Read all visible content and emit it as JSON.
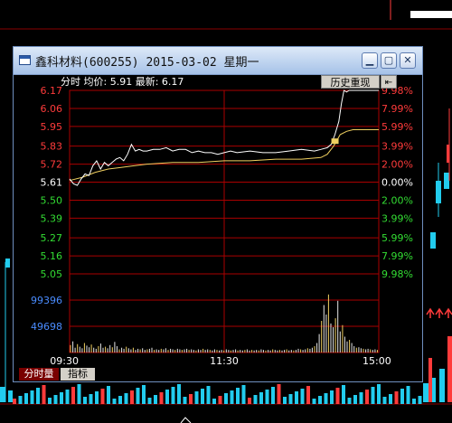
{
  "window": {
    "title": "鑫科材料(600255) 2015-03-02 星期一",
    "min_glyph": "▁",
    "max_glyph": "▢",
    "close_glyph": "✕"
  },
  "header": {
    "line": "分时 均价: 5.91 最新: 6.17",
    "history_button": "历史重现",
    "jump_glyph": "⇤"
  },
  "tabs": [
    "分时量",
    "指标"
  ],
  "colors": {
    "up": "#ff3b3b",
    "down": "#33dd33",
    "neutral": "#ffffff",
    "grid": "#aa0000",
    "price_line": "#ffffff",
    "avg_line": "#f0d060",
    "volume": "#e8e8e8"
  },
  "chart_data": {
    "type": "line",
    "price_axis": {
      "ticks": [
        "6.17",
        "6.06",
        "5.95",
        "5.83",
        "5.72",
        "5.61",
        "5.50",
        "5.39",
        "5.27",
        "5.16",
        "5.05"
      ],
      "tick_values": [
        6.17,
        6.06,
        5.95,
        5.83,
        5.72,
        5.61,
        5.5,
        5.39,
        5.27,
        5.16,
        5.05
      ],
      "ylim": [
        5.05,
        6.17
      ],
      "prev_close": 5.61
    },
    "pct_axis": [
      "9.98%",
      "7.99%",
      "5.99%",
      "3.99%",
      "2.00%",
      "0.00%",
      "2.00%",
      "3.99%",
      "5.99%",
      "7.99%",
      "9.98%"
    ],
    "volume_axis": {
      "ticks": [
        "99396",
        "49698"
      ],
      "tick_values": [
        99396,
        49698
      ],
      "ylim": [
        0,
        149094
      ]
    },
    "time_labels": [
      "09:30",
      "11:30",
      "15:00"
    ],
    "series": [
      {
        "minute": [
          0,
          3,
          6,
          9,
          12,
          15,
          18,
          21,
          24,
          27,
          30,
          33,
          36,
          39,
          42,
          45,
          48,
          51,
          54,
          57,
          60,
          65,
          70,
          75,
          80,
          85,
          90,
          95,
          100,
          105,
          110,
          115,
          120,
          125,
          130,
          140,
          150,
          160,
          170,
          180,
          190,
          195,
          200,
          203,
          206,
          209,
          211,
          213,
          215,
          217,
          220,
          225,
          230,
          235,
          240
        ],
        "values": [
          5.63,
          5.6,
          5.59,
          5.63,
          5.66,
          5.65,
          5.71,
          5.74,
          5.69,
          5.73,
          5.71,
          5.73,
          5.75,
          5.76,
          5.74,
          5.78,
          5.84,
          5.8,
          5.81,
          5.8,
          5.8,
          5.81,
          5.81,
          5.82,
          5.8,
          5.81,
          5.81,
          5.79,
          5.8,
          5.79,
          5.79,
          5.78,
          5.79,
          5.8,
          5.79,
          5.8,
          5.79,
          5.79,
          5.8,
          5.81,
          5.8,
          5.81,
          5.82,
          5.84,
          5.9,
          5.98,
          6.09,
          6.17,
          6.16,
          6.17,
          6.17,
          6.17,
          6.17,
          6.17,
          6.17
        ]
      },
      {
        "minute": [
          0,
          10,
          20,
          30,
          40,
          50,
          60,
          80,
          100,
          120,
          140,
          160,
          180,
          195,
          200,
          205,
          210,
          215,
          220,
          230,
          240
        ],
        "values": [
          5.62,
          5.64,
          5.67,
          5.69,
          5.7,
          5.71,
          5.72,
          5.73,
          5.73,
          5.74,
          5.74,
          5.75,
          5.75,
          5.76,
          5.78,
          5.83,
          5.9,
          5.92,
          5.93,
          5.93,
          5.93
        ]
      }
    ],
    "volume": [
      14000,
      21000,
      9000,
      16000,
      11000,
      8000,
      18000,
      13000,
      10000,
      15000,
      9000,
      7000,
      12000,
      17000,
      9000,
      11000,
      8000,
      14000,
      10000,
      20000,
      12000,
      6000,
      9000,
      7000,
      11000,
      8000,
      6000,
      9000,
      5000,
      7000,
      6000,
      8000,
      5000,
      6000,
      7000,
      9000,
      5000,
      6000,
      5000,
      7000,
      6000,
      8000,
      5000,
      7000,
      6000,
      5000,
      7000,
      6000,
      5000,
      6000,
      7000,
      5000,
      6000,
      5000,
      4000,
      6000,
      5000,
      7000,
      5000,
      6000,
      5000,
      4000,
      6000,
      5000,
      4000,
      5000,
      4000,
      6000,
      5000,
      4000,
      5000,
      6000,
      4000,
      5000,
      4000,
      5000,
      6000,
      4000,
      5000,
      4000,
      5000,
      4000,
      6000,
      5000,
      4000,
      5000,
      4000,
      6000,
      5000,
      4000,
      5000,
      4000,
      5000,
      6000,
      4000,
      5000,
      4000,
      5000,
      7000,
      6000,
      5000,
      6000,
      8000,
      7000,
      9000,
      12000,
      18000,
      35000,
      60000,
      90000,
      72000,
      110000,
      55000,
      48000,
      65000,
      98000,
      40000,
      52000,
      30000,
      21000,
      24000,
      18000,
      12000,
      9000,
      10000,
      8000,
      7000,
      6000,
      7000,
      6000,
      5000,
      6000,
      5000
    ]
  }
}
